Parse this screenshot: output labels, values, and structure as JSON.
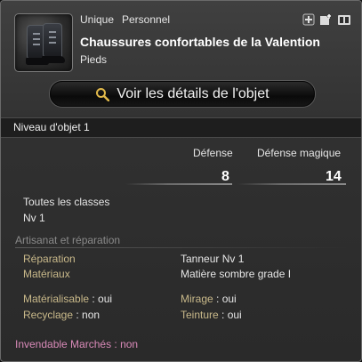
{
  "item": {
    "tag_unique": "Unique",
    "tag_personal": "Personnel",
    "name": "Chaussures confortables de la Valention",
    "slot": "Pieds",
    "icon": "boots-icon"
  },
  "header_icons": [
    "cannot-dye-icon",
    "can-equip-icon",
    "armoire-icon"
  ],
  "view_details_button": {
    "label": "Voir les détails de l'objet",
    "icon": "magnifier-icon"
  },
  "item_level": "Niveau d'objet 1",
  "stats": {
    "defense_label": "Défense",
    "defense_value": "8",
    "magic_defense_label": "Défense magique",
    "magic_defense_value": "14"
  },
  "requirements": {
    "classes": "Toutes les classes",
    "level": "Nv 1"
  },
  "crafting": {
    "section_title": "Artisanat et réparation",
    "repair_label": "Réparation",
    "repair_value": "Tanneur Nv 1",
    "materials_label": "Matériaux",
    "materials_value": "Matière sombre grade I",
    "materialize_label": "Matérialisable",
    "materialize_value": " : oui",
    "mirage_label": "Mirage",
    "mirage_value": " : oui",
    "recycle_label": "Recyclage",
    "recycle_value": " : non",
    "dye_label": "Teinture",
    "dye_value": " : oui"
  },
  "market": {
    "unsellable": "Invendable Marchés : non"
  },
  "colors": {
    "accent_label": "#c9b98a",
    "unsellable": "#d98ab8",
    "section_title": "#8a8a8a"
  }
}
